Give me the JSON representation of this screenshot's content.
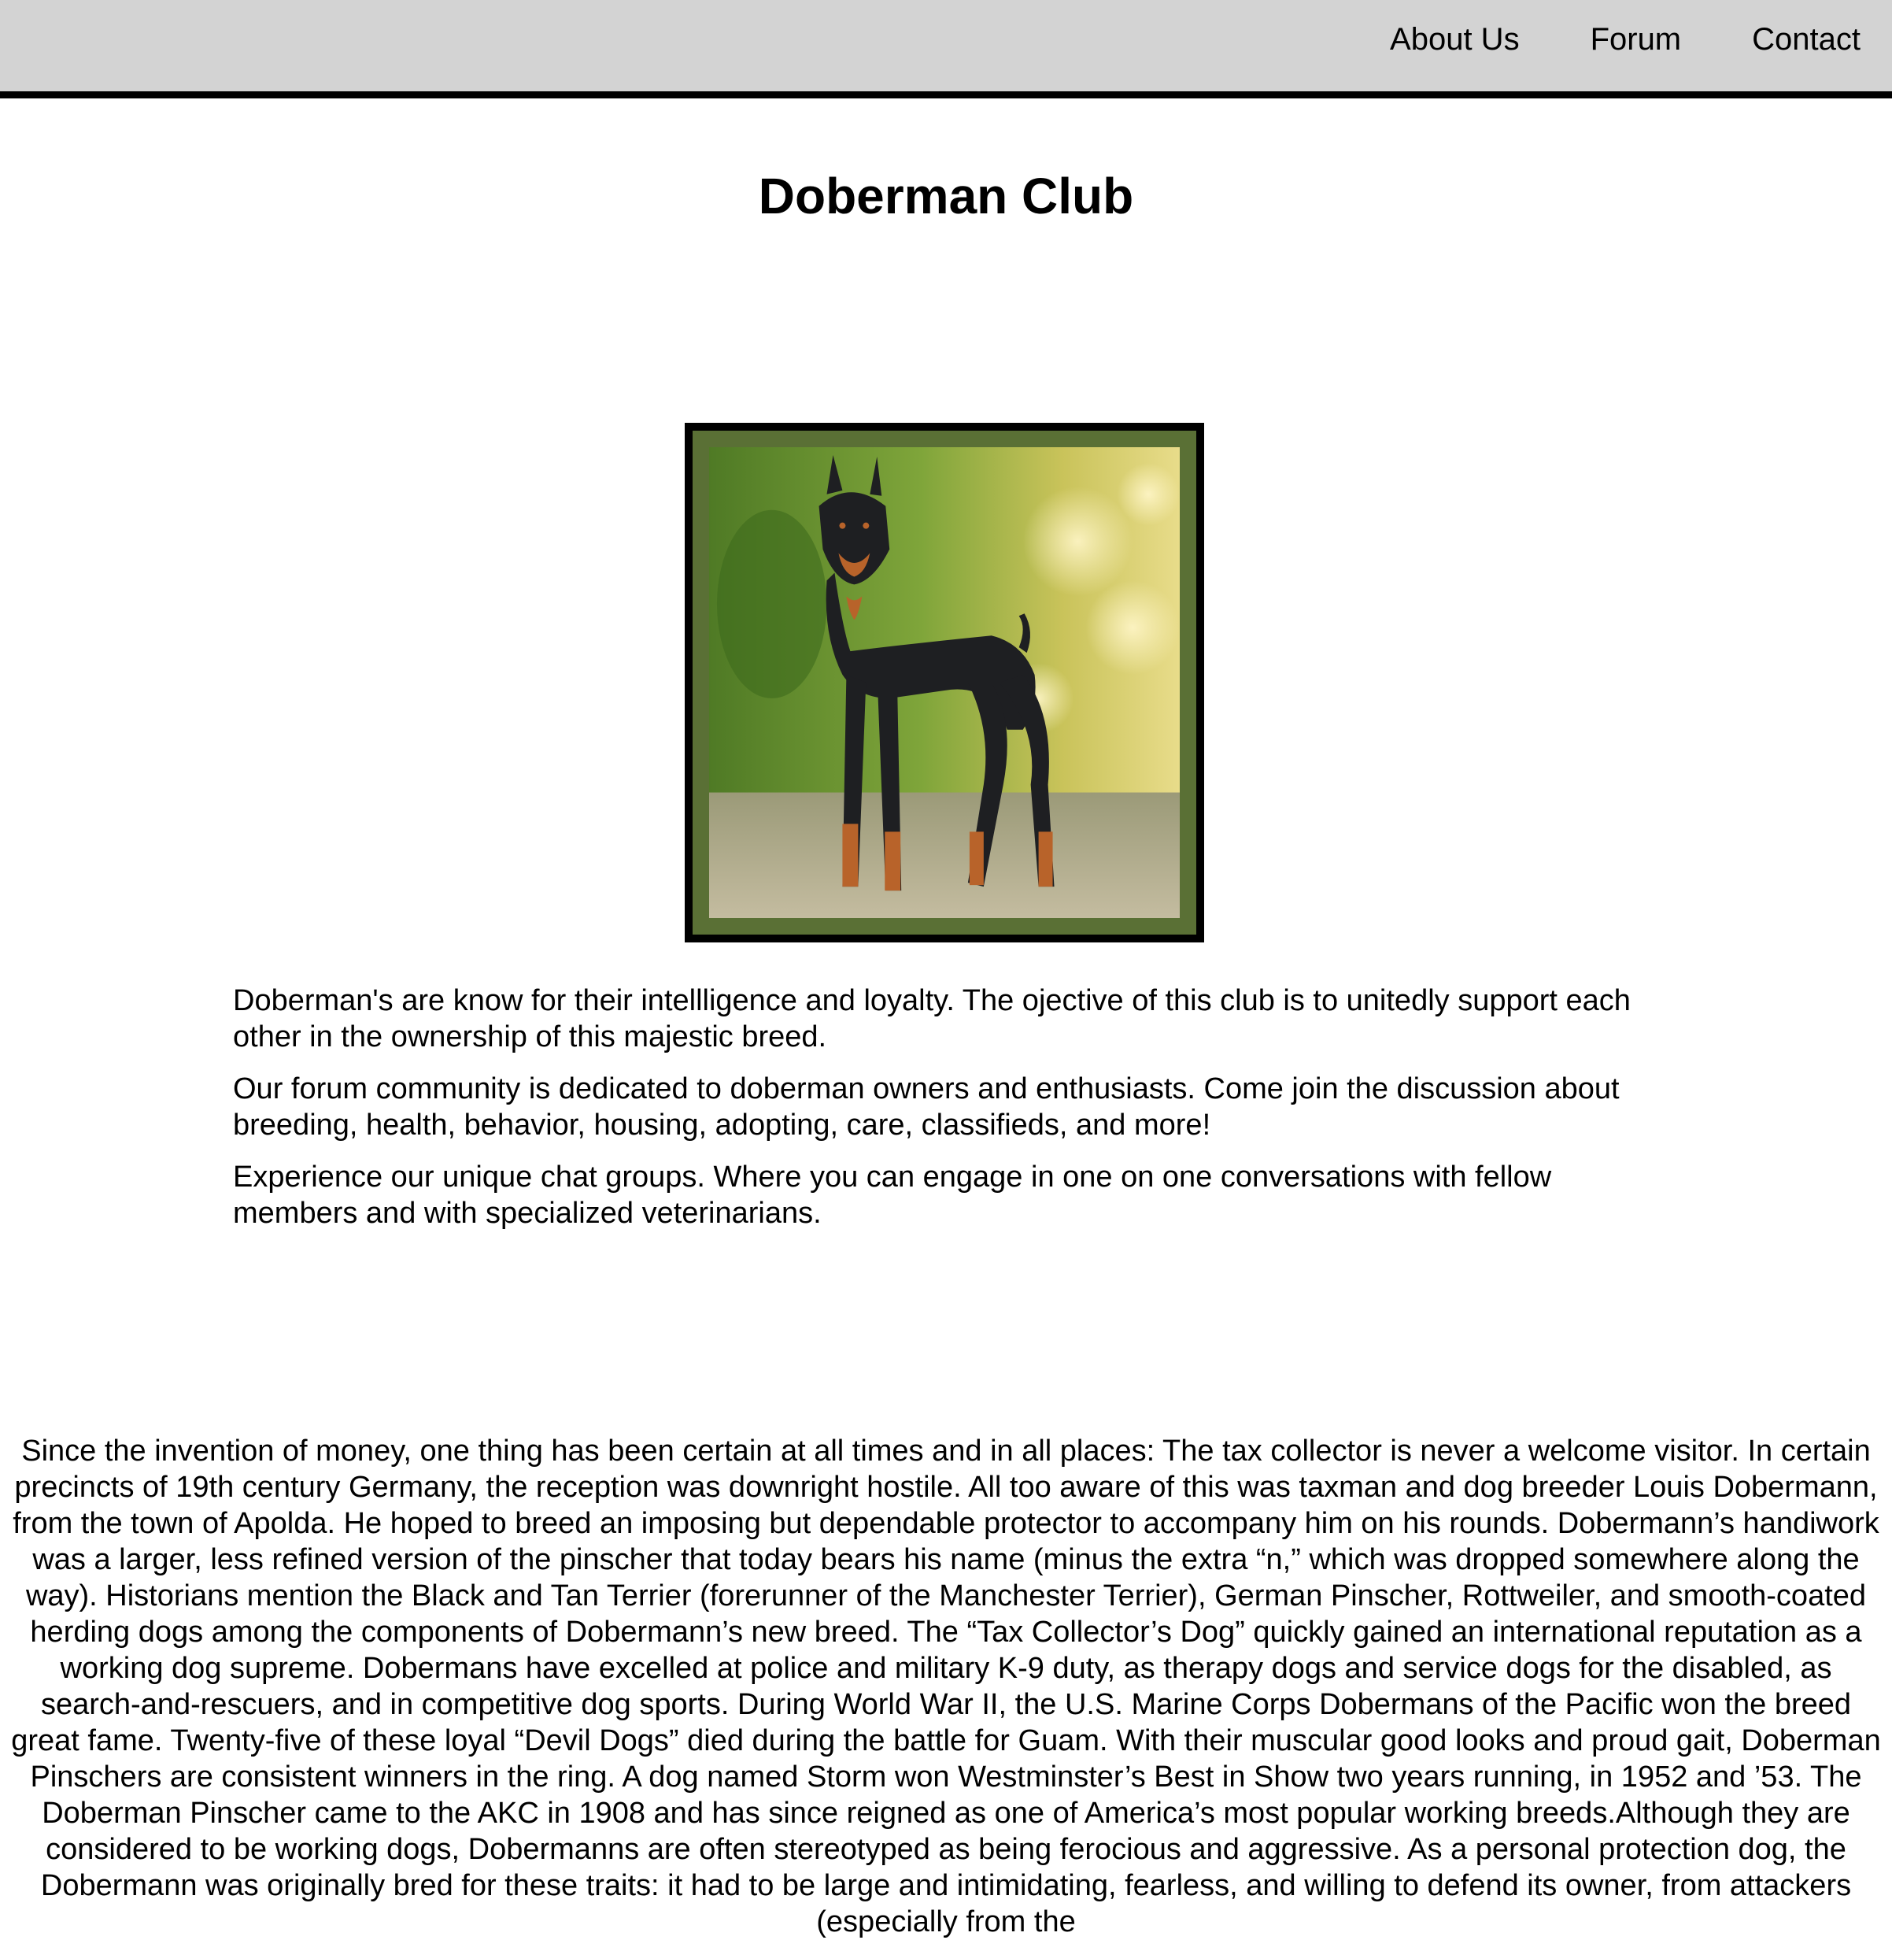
{
  "nav": {
    "links": [
      "About Us",
      "Forum",
      "Contact"
    ]
  },
  "header": {
    "title": "Doberman Club"
  },
  "hero_image": {
    "subject": "doberman-photo"
  },
  "intro": {
    "paragraphs": [
      "Doberman's are know for their intellligence and loyalty. The ojective of this club is to unitedly support each other in the ownership of this majestic breed.",
      "Our forum community is dedicated to doberman owners and enthusiasts. Come join the discussion about breeding, health, behavior, housing, adopting, care, classifieds, and more!",
      "Experience our unique chat groups. Where you can engage in one on one conversations with fellow members and with specialized veterinarians."
    ]
  },
  "history": {
    "text": "Since the invention of money, one thing has been certain at all times and in all places: The tax collector is never a welcome visitor. In certain precincts of 19th century Germany, the reception was downright hostile. All too aware of this was taxman and dog breeder Louis Dobermann, from the town of Apolda. He hoped to breed an imposing but dependable protector to accompany him on his rounds. Dobermann’s handiwork was a larger, less refined version of the pinscher that today bears his name (minus the extra “n,” which was dropped somewhere along the way). Historians mention the Black and Tan Terrier (forerunner of the Manchester Terrier), German Pinscher, Rottweiler, and smooth-coated herding dogs among the components of Dobermann’s new breed. The “Tax Collector’s Dog” quickly gained an international reputation as a working dog supreme. Dobermans have excelled at police and military K-9 duty, as therapy dogs and service dogs for the disabled, as search-and-rescuers, and in competitive dog sports. During World War II, the U.S. Marine Corps Dobermans of the Pacific won the breed great fame. Twenty-five of these loyal “Devil Dogs” died during the battle for Guam. With their muscular good looks and proud gait, Doberman Pinschers are consistent winners in the ring. A dog named Storm won Westminster’s Best in Show two years running, in 1952 and ’53. The Doberman Pinscher came to the AKC in 1908 and has since reigned as one of America’s most popular working breeds.Although they are considered to be working dogs, Dobermanns are often stereotyped as being ferocious and aggressive. As a personal protection dog, the Dobermann was originally bred for these traits: it had to be large and intimidating, fearless, and willing to defend its owner, from attackers (especially from the"
  },
  "colors": {
    "navbar_bg": "#d3d3d3",
    "frame_border": "#000000",
    "frame_mat": "#5a7035"
  }
}
